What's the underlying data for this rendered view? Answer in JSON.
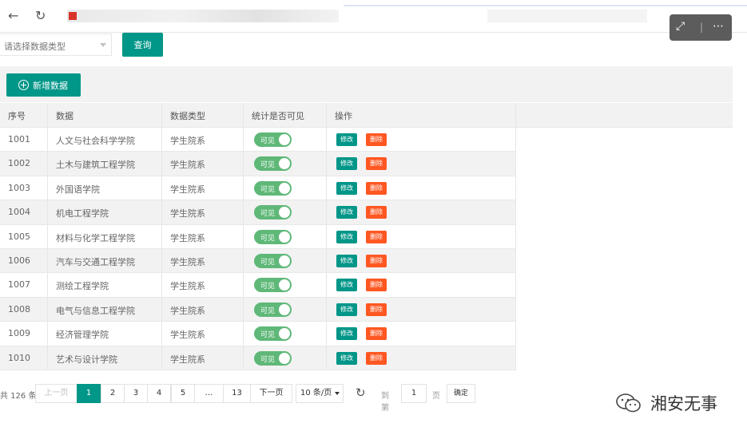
{
  "browser": {
    "back_icon": "arrow-left-icon",
    "reload_icon": "reload-icon"
  },
  "search": {
    "select_placeholder": "请选择数据类型",
    "query_label": "查询"
  },
  "toolbar": {
    "add_label": "新增数据"
  },
  "table": {
    "headers": [
      "序号",
      "数据",
      "数据类型",
      "统计是否可见",
      "操作"
    ],
    "rows": [
      {
        "id": "1001",
        "name": "人文与社会科学学院",
        "type": "学生院系",
        "visible": "可见"
      },
      {
        "id": "1002",
        "name": "土木与建筑工程学院",
        "type": "学生院系",
        "visible": "可见"
      },
      {
        "id": "1003",
        "name": "外国语学院",
        "type": "学生院系",
        "visible": "可见"
      },
      {
        "id": "1004",
        "name": "机电工程学院",
        "type": "学生院系",
        "visible": "可见"
      },
      {
        "id": "1005",
        "name": "材料与化学工程学院",
        "type": "学生院系",
        "visible": "可见"
      },
      {
        "id": "1006",
        "name": "汽车与交通工程学院",
        "type": "学生院系",
        "visible": "可见"
      },
      {
        "id": "1007",
        "name": "测绘工程学院",
        "type": "学生院系",
        "visible": "可见"
      },
      {
        "id": "1008",
        "name": "电气与信息工程学院",
        "type": "学生院系",
        "visible": "可见"
      },
      {
        "id": "1009",
        "name": "经济管理学院",
        "type": "学生院系",
        "visible": "可见"
      },
      {
        "id": "1010",
        "name": "艺术与设计学院",
        "type": "学生院系",
        "visible": "可见"
      }
    ],
    "edit_label": "修改",
    "delete_label": "删除"
  },
  "pagination": {
    "total": "共 126 条",
    "prev": "上一页",
    "pages": [
      "1",
      "2",
      "3",
      "4",
      "5",
      "…",
      "13"
    ],
    "current": "1",
    "next": "下一页",
    "limit": "10 条/页",
    "goto_label": "到第",
    "goto_value": "1",
    "page_label": "页",
    "confirm": "确定"
  },
  "watermark": {
    "text": "湘安无事"
  },
  "colors": {
    "primary": "#009688",
    "danger": "#ff5722",
    "switch_on": "#5fb878"
  }
}
